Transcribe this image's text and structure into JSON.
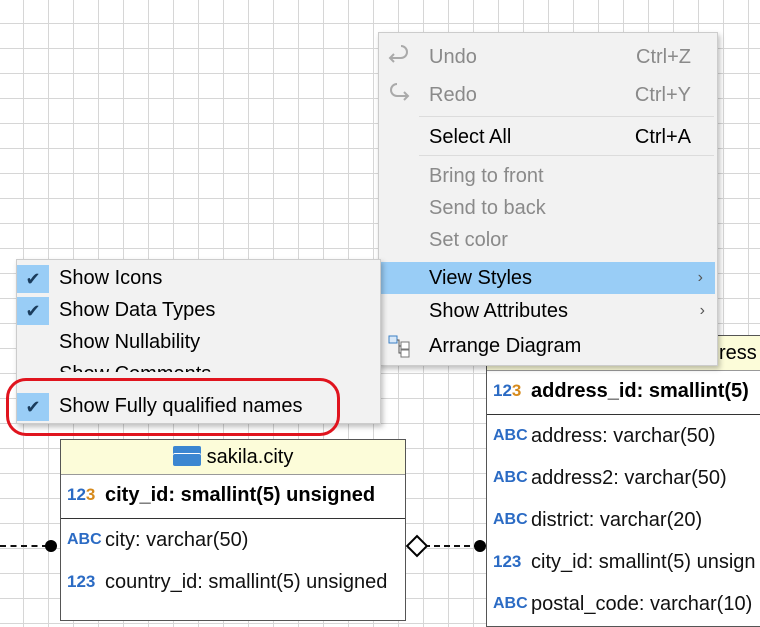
{
  "context_menu": {
    "items": [
      {
        "label": "Undo",
        "shortcut": "Ctrl+Z",
        "icon": "undo-icon",
        "enabled": false
      },
      {
        "label": "Redo",
        "shortcut": "Ctrl+Y",
        "icon": "redo-icon",
        "enabled": false
      },
      {
        "label": "Select All",
        "shortcut": "Ctrl+A",
        "enabled": true
      },
      {
        "label": "Bring to front",
        "enabled": false
      },
      {
        "label": "Send to back",
        "enabled": false
      },
      {
        "label": "Set color",
        "enabled": false
      },
      {
        "label": "View Styles",
        "submenu": true,
        "highlighted": true
      },
      {
        "label": "Show Attributes",
        "submenu": true
      },
      {
        "label": "Arrange Diagram",
        "icon": "arrange-diagram-icon"
      }
    ]
  },
  "view_styles_submenu": {
    "items": [
      {
        "label": "Show Icons",
        "checked": true
      },
      {
        "label": "Show Data Types",
        "checked": true
      },
      {
        "label": "Show Nullability",
        "checked": false
      },
      {
        "label": "Show Comments",
        "checked": false
      },
      {
        "label": "Show Fully qualified names",
        "checked": true
      }
    ]
  },
  "city_table": {
    "title": "sakila.city",
    "pk": "city_id: smallint(5) unsigned",
    "columns": [
      {
        "icon": "ABC",
        "text": "city: varchar(50)"
      },
      {
        "icon": "123",
        "text": "country_id: smallint(5) unsigned"
      }
    ]
  },
  "address_table": {
    "title_fragment": "ress",
    "pk": "address_id: smallint(5)",
    "columns": [
      {
        "icon": "ABC",
        "text": "address: varchar(50)"
      },
      {
        "icon": "ABC",
        "text": "address2: varchar(50)"
      },
      {
        "icon": "ABC",
        "text": "district: varchar(20)"
      },
      {
        "icon": "123",
        "text": "city_id: smallint(5) unsign"
      },
      {
        "icon": "ABC",
        "text": "postal_code: varchar(10)"
      }
    ]
  },
  "colors": {
    "highlight": "#99cdf6",
    "callout": "#e0141e",
    "table_header": "#fcfcd9"
  }
}
